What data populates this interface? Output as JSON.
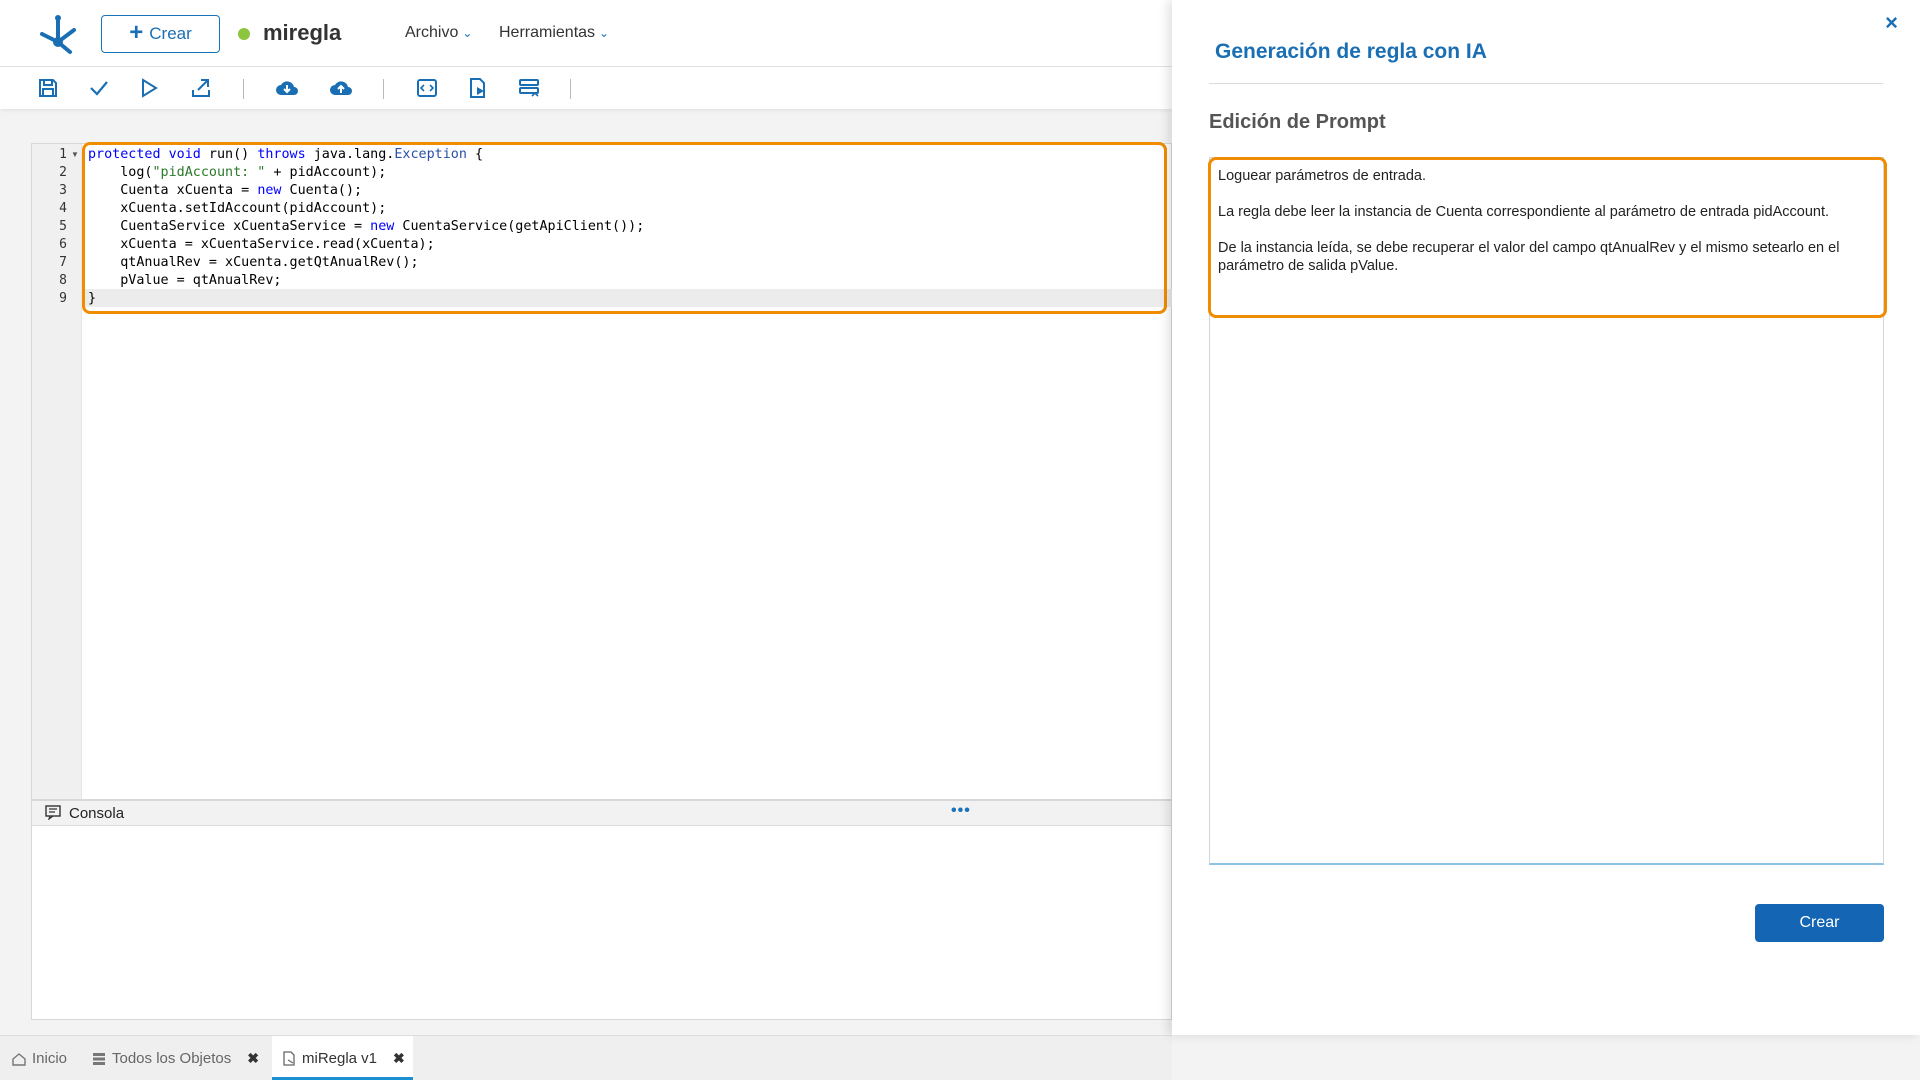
{
  "header": {
    "create_label": "Crear",
    "rule_name": "miregla",
    "status_color": "#8cc63f",
    "menus": [
      "Archivo",
      "Herramientas"
    ]
  },
  "toolbar": {
    "icons": [
      "save-icon",
      "check-icon",
      "run-icon",
      "export-icon",
      "download-cloud-icon",
      "upload-cloud-icon",
      "code-icon",
      "document-run-icon",
      "list-settings-icon"
    ]
  },
  "editor": {
    "line_numbers": [
      "1",
      "2",
      "3",
      "4",
      "5",
      "6",
      "7",
      "8",
      "9"
    ],
    "lines": [
      "protected void run() throws java.lang.Exception {",
      "    log(\"pidAccount: \" + pidAccount);",
      "    Cuenta xCuenta = new Cuenta();",
      "    xCuenta.setIdAccount(pidAccount);",
      "    CuentaService xCuentaService = new CuentaService(getApiClient());",
      "    xCuenta = xCuentaService.read(xCuenta);",
      "    qtAnualRev = xCuenta.getQtAnualRev();",
      "    pValue = qtAnualRev;",
      "}"
    ]
  },
  "console": {
    "title": "Consola",
    "menu_label": "•••"
  },
  "tabs": {
    "inicio": "Inicio",
    "todos": "Todos los Objetos",
    "miregla": "miRegla v1"
  },
  "panel": {
    "title": "Generación de regla con IA",
    "section_title": "Edición de Prompt",
    "close_label": "×",
    "prompt": [
      "Loguear parámetros de entrada.",
      "La regla debe leer la instancia de Cuenta correspondiente al parámetro de entrada pidAccount.",
      "De la instancia leída, se debe recuperar el valor del campo qtAnualRev y el mismo setearlo en el parámetro de salida pValue."
    ],
    "submit_label": "Crear"
  },
  "colors": {
    "accent": "#1a6fb4",
    "highlight": "#f08c00",
    "submit_bg": "#1565b5"
  }
}
